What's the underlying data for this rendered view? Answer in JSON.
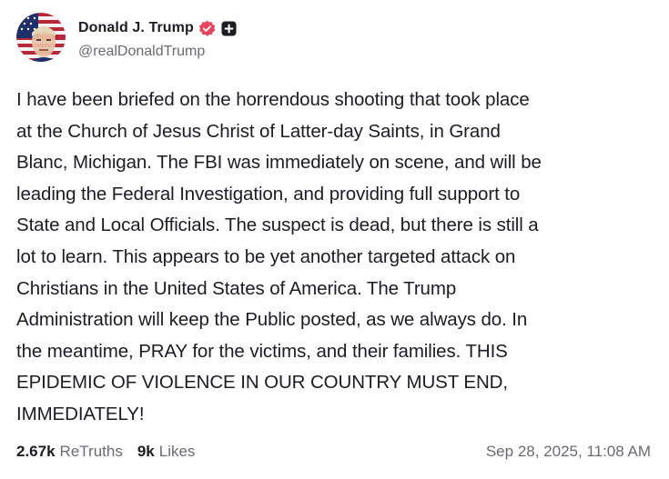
{
  "author": {
    "display_name": "Donald J. Trump",
    "handle": "@realDonaldTrump",
    "verified_icon": "verified-badge-icon",
    "plus_icon": "plus-badge-icon"
  },
  "post": {
    "lines": [
      "I have been briefed on the horrendous shooting that took place",
      "at the Church of Jesus Christ of Latter-day Saints, in Grand",
      "Blanc, Michigan. The FBI was immediately on scene, and will be",
      "leading the Federal Investigation, and providing full support to",
      "State and Local Officials. The suspect is dead, but there is still a",
      "lot to learn. This appears to be yet another targeted attack on",
      "Christians in the United States of America. The Trump",
      "Administration will keep the Public posted, as we always do. In",
      "the meantime, PRAY for the victims, and their families. THIS",
      "EPIDEMIC OF VIOLENCE IN OUR COUNTRY MUST END,",
      "IMMEDIATELY!"
    ]
  },
  "stats": {
    "retruths_count": "2.67k",
    "retruths_label": "ReTruths",
    "likes_count": "9k",
    "likes_label": "Likes"
  },
  "timestamp": "Sep 28, 2025, 11:08 AM",
  "colors": {
    "verified": "#e8445a",
    "text": "#1c1c22",
    "muted": "#6a6a73"
  }
}
